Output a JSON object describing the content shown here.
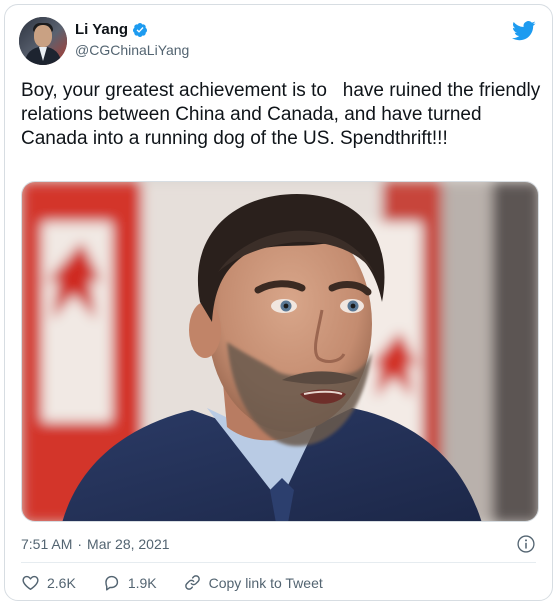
{
  "author": {
    "display_name": "Li Yang",
    "handle": "@CGChinaLiYang",
    "verified": true
  },
  "tweet": {
    "text": "Boy, your greatest achievement is to   have ruined the friendly relations between China and Canada, and have turned Canada into a running dog of the US. Spendthrift!!!",
    "time": "7:51 AM",
    "separator": "·",
    "date": "Mar 28, 2021"
  },
  "actions": {
    "likes": "2.6K",
    "replies": "1.9K",
    "copy_link_label": "Copy link to Tweet"
  },
  "colors": {
    "twitter_blue": "#1d9bf0",
    "text_secondary": "#536471",
    "flag_red": "#d52b1e"
  },
  "icons": {
    "brand": "twitter-bird-icon",
    "verified": "verified-badge-icon",
    "info": "info-icon",
    "like": "heart-icon",
    "reply": "reply-bubble-icon",
    "link": "link-icon"
  }
}
